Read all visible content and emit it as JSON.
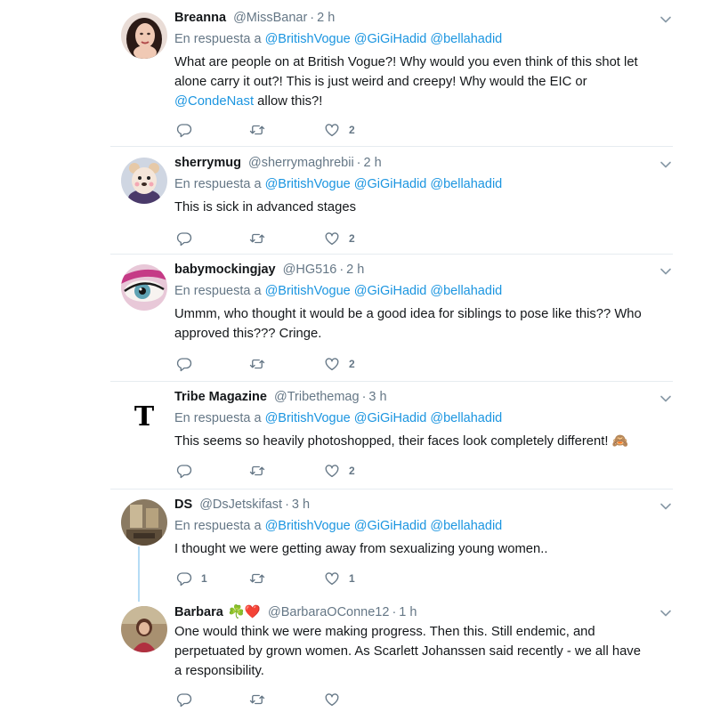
{
  "tweets": [
    {
      "name": "Breanna",
      "handle": "@MissBanar",
      "time": "2 h",
      "reply_prefix": "En respuesta a",
      "mentions": [
        "@BritishVogue",
        "@GiGiHadid",
        "@bellahadid"
      ],
      "text_parts": [
        "What are people on at British Vogue?! Why would you even think of this shot let alone carry it out?! This is just weird and creepy! Why would the EIC or ",
        "@CondeNast",
        " allow this?!"
      ],
      "reply_count": "",
      "retweet_count": "",
      "like_count": "2",
      "avatar_icon": "woman-portrait-avatar"
    },
    {
      "name": "sherrymug",
      "handle": "@sherrymaghrebii",
      "time": "2 h",
      "reply_prefix": "En respuesta a",
      "mentions": [
        "@BritishVogue",
        "@GiGiHadid",
        "@bellahadid"
      ],
      "text": "This is sick in advanced stages",
      "reply_count": "",
      "retweet_count": "",
      "like_count": "2",
      "avatar_icon": "bear-filter-avatar"
    },
    {
      "name": "babymockingjay",
      "handle": "@HG516",
      "time": "2 h",
      "reply_prefix": "En respuesta a",
      "mentions": [
        "@BritishVogue",
        "@GiGiHadid",
        "@bellahadid"
      ],
      "text": "Ummm, who thought it would be a good idea for siblings to pose like this?? Who approved this??? Cringe.",
      "reply_count": "",
      "retweet_count": "",
      "like_count": "2",
      "avatar_icon": "eye-closeup-avatar"
    },
    {
      "name": "Tribe Magazine",
      "handle": "@Tribethemag",
      "time": "3 h",
      "reply_prefix": "En respuesta a",
      "mentions": [
        "@BritishVogue",
        "@GiGiHadid",
        "@bellahadid"
      ],
      "text": "This seems so heavily photoshopped, their faces look completely different!",
      "emoji": "🙈",
      "reply_count": "",
      "retweet_count": "",
      "like_count": "2",
      "avatar_icon": "letter-t-logo-avatar",
      "avatar_letter": "T"
    },
    {
      "name": "DS",
      "handle": "@DsJetskifast",
      "time": "3 h",
      "reply_prefix": "En respuesta a",
      "mentions": [
        "@BritishVogue",
        "@GiGiHadid",
        "@bellahadid"
      ],
      "text": "I thought we were getting away from sexualizing young women..",
      "reply_count": "1",
      "retweet_count": "",
      "like_count": "1",
      "avatar_icon": "room-photo-avatar"
    },
    {
      "name": "Barbara",
      "name_emojis": "☘️❤️",
      "handle": "@BarbaraOConne12",
      "time": "1 h",
      "text": "One would think we were making progress. Then this. Still endemic, and perpetuated by grown women. As Scarlett Johanssen said recently - we all have a responsibility.",
      "reply_count": "",
      "retweet_count": "",
      "like_count": "",
      "avatar_icon": "woman-photo-avatar"
    }
  ],
  "colors": {
    "mention": "#1b95e0",
    "secondary_text": "#657786",
    "divider": "#e6ecf0",
    "thread_line": "#b6dcf5"
  }
}
